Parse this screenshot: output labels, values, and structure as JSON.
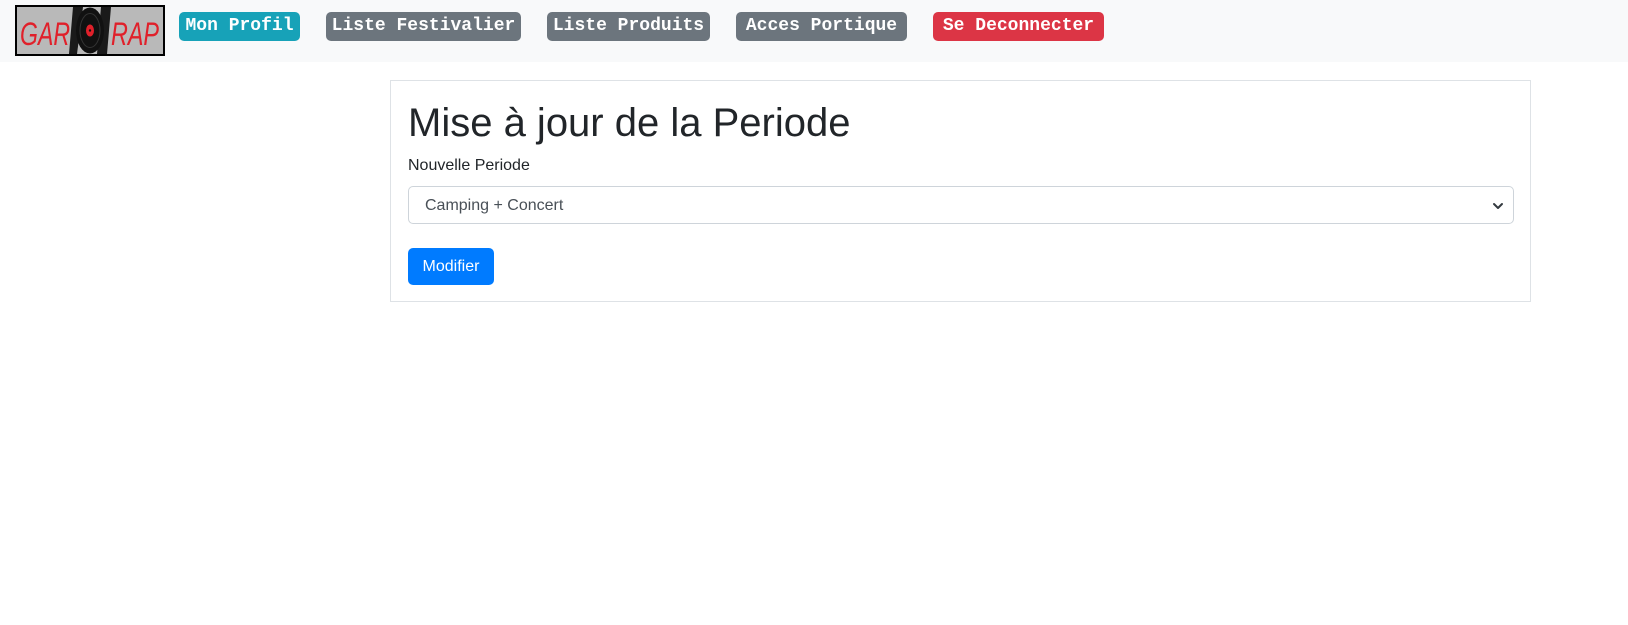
{
  "brand": {
    "logo_text_left": "GAR",
    "logo_text_right": "RAP"
  },
  "nav": {
    "profile": "Mon Profil",
    "festivaliers": "Liste Festivalier",
    "produits": "Liste Produits",
    "portique": "Acces Portique",
    "logout": "Se Deconnecter"
  },
  "form": {
    "title": "Mise à jour de la Periode",
    "field_label": "Nouvelle Periode",
    "selected_value": "Camping + Concert",
    "submit_label": "Modifier"
  },
  "colors": {
    "info": "#17a2b8",
    "secondary": "#6c757d",
    "danger": "#dc3545",
    "primary": "#007bff",
    "logo_text": "#e0202a"
  },
  "icons": {
    "logo": "vinyl-record-icon",
    "select_arrow": "chevron-down-icon"
  }
}
